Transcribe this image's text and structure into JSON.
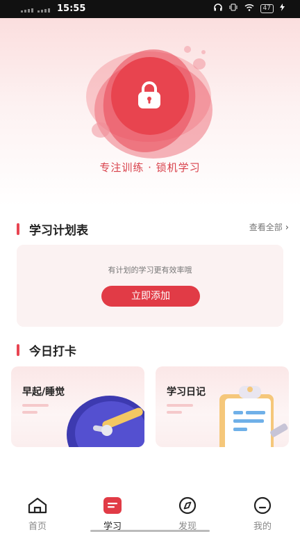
{
  "status_bar": {
    "time": "15:55",
    "battery": "47"
  },
  "hero": {
    "tagline": "专注训练 · 锁机学习",
    "icon": "lock-icon"
  },
  "plan_section": {
    "title": "学习计划表",
    "view_all": "查看全部",
    "empty_hint": "有计划的学习更有效率哦",
    "add_button": "立即添加"
  },
  "checkin_section": {
    "title": "今日打卡",
    "cards": [
      {
        "label": "早起/睡觉",
        "icon": "clock-icon"
      },
      {
        "label": "学习日记",
        "icon": "clipboard-icon"
      }
    ]
  },
  "tab_bar": {
    "items": [
      {
        "label": "首页",
        "icon": "home-icon",
        "active": false
      },
      {
        "label": "学习",
        "icon": "study-icon",
        "active": true
      },
      {
        "label": "发现",
        "icon": "compass-icon",
        "active": false
      },
      {
        "label": "我的",
        "icon": "profile-icon",
        "active": false
      }
    ]
  },
  "colors": {
    "accent": "#e13b46",
    "tagline": "#d8404a",
    "card_bg": "#fbf2f2"
  }
}
